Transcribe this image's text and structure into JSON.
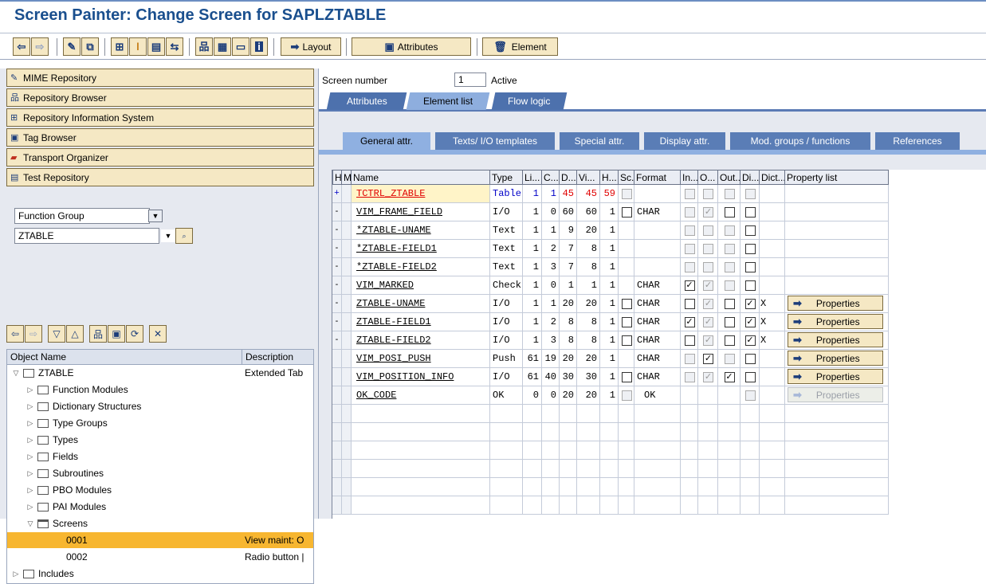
{
  "title": "Screen Painter: Change Screen for SAPLZTABLE",
  "toolbar": {
    "icons": [
      "back-icon",
      "forward-icon",
      "pencil-display-change-icon",
      "activate-icon",
      "where-used-icon",
      "check-icon",
      "object-list-icon",
      "navigation-icon",
      "hierarchy-icon",
      "program-icon",
      "screen-icon",
      "info-icon"
    ],
    "layout_label": "Layout",
    "attributes_label": "Attributes",
    "element_label": "Element"
  },
  "nav": [
    "MIME Repository",
    "Repository Browser",
    "Repository Information System",
    "Tag Browser",
    "Transport Organizer",
    "Test Repository"
  ],
  "object_type": "Function Group",
  "object_name": "ZTABLE",
  "tree": {
    "col_name": "Object Name",
    "col_desc": "Description",
    "root": {
      "label": "ZTABLE",
      "desc": "Extended Tab"
    },
    "folders": [
      "Function Modules",
      "Dictionary Structures",
      "Type Groups",
      "Types",
      "Fields",
      "Subroutines",
      "PBO Modules",
      "PAI Modules"
    ],
    "screens_label": "Screens",
    "screens": [
      {
        "label": "0001",
        "desc": "View maint: O"
      },
      {
        "label": "0002",
        "desc": "Radio button |"
      }
    ],
    "includes_label": "Includes"
  },
  "screen": {
    "label": "Screen number",
    "value": "1",
    "status": "Active"
  },
  "tabs": [
    "Attributes",
    "Element list",
    "Flow logic"
  ],
  "subtabs": [
    "General attr.",
    "Texts/ I/O templates",
    "Special attr.",
    "Display attr.",
    "Mod. groups / functions",
    "References"
  ],
  "grid": {
    "headers": [
      "H",
      "M",
      "Name",
      "Type",
      "Li...",
      "C...",
      "D...",
      "Vi...",
      "H...",
      "Sc...",
      "Format",
      "In...",
      "O...",
      "Out...",
      "Di...",
      "Dict...",
      "Property list"
    ],
    "rows": [
      {
        "h": "+",
        "name": "TCTRL_ZTABLE",
        "type": "Table",
        "li": "1",
        "c": "1",
        "d": "45",
        "vi": "45",
        "hh": "59",
        "sc": "dis",
        "format": "",
        "in": "dis",
        "o": "dis",
        "out": "dis",
        "di": "dis",
        "dict": "",
        "prop": "",
        "special": "tctrl"
      },
      {
        "h": "-",
        "name": "VIM_FRAME_FIELD",
        "type": "I/O",
        "li": "1",
        "c": "0",
        "d": "60",
        "vi": "60",
        "hh": "1",
        "sc": "off",
        "format": "CHAR",
        "in": "dis",
        "o": "disck",
        "out": "off",
        "di": "off",
        "dict": "",
        "prop": ""
      },
      {
        "h": "-",
        "name": "*ZTABLE-UNAME",
        "type": "Text",
        "li": "1",
        "c": "1",
        "d": "9",
        "vi": "20",
        "hh": "1",
        "sc": "",
        "format": "",
        "in": "dis",
        "o": "dis",
        "out": "dis",
        "di": "off",
        "dict": "",
        "prop": ""
      },
      {
        "h": "-",
        "name": "*ZTABLE-FIELD1",
        "type": "Text",
        "li": "1",
        "c": "2",
        "d": "7",
        "vi": "8",
        "hh": "1",
        "sc": "",
        "format": "",
        "in": "dis",
        "o": "dis",
        "out": "dis",
        "di": "off",
        "dict": "",
        "prop": ""
      },
      {
        "h": "-",
        "name": "*ZTABLE-FIELD2",
        "type": "Text",
        "li": "1",
        "c": "3",
        "d": "7",
        "vi": "8",
        "hh": "1",
        "sc": "",
        "format": "",
        "in": "dis",
        "o": "dis",
        "out": "dis",
        "di": "off",
        "dict": "",
        "prop": ""
      },
      {
        "h": "-",
        "name": "VIM_MARKED",
        "type": "Check",
        "li": "1",
        "c": "0",
        "d": "1",
        "vi": "1",
        "hh": "1",
        "sc": "",
        "format": "CHAR",
        "in": "on",
        "o": "disck",
        "out": "dis",
        "di": "off",
        "dict": "",
        "prop": ""
      },
      {
        "h": "-",
        "name": "ZTABLE-UNAME",
        "type": "I/O",
        "li": "1",
        "c": "1",
        "d": "20",
        "vi": "20",
        "hh": "1",
        "sc": "off",
        "format": "CHAR",
        "in": "off",
        "o": "disck",
        "out": "off",
        "di": "on",
        "dict": "X",
        "prop": "Properties"
      },
      {
        "h": "-",
        "name": "ZTABLE-FIELD1",
        "type": "I/O",
        "li": "1",
        "c": "2",
        "d": "8",
        "vi": "8",
        "hh": "1",
        "sc": "off",
        "format": "CHAR",
        "in": "on",
        "o": "disck",
        "out": "off",
        "di": "on",
        "dict": "X",
        "prop": "Properties"
      },
      {
        "h": "-",
        "name": "ZTABLE-FIELD2",
        "type": "I/O",
        "li": "1",
        "c": "3",
        "d": "8",
        "vi": "8",
        "hh": "1",
        "sc": "off",
        "format": "CHAR",
        "in": "off",
        "o": "disck",
        "out": "off",
        "di": "on",
        "dict": "X",
        "prop": "Properties"
      },
      {
        "h": "",
        "name": "VIM_POSI_PUSH",
        "type": "Push",
        "li": "61",
        "c": "19",
        "d": "20",
        "vi": "20",
        "hh": "1",
        "sc": "",
        "format": "CHAR",
        "in": "dis",
        "o": "on",
        "out": "dis",
        "di": "off",
        "dict": "",
        "prop": "Properties"
      },
      {
        "h": "",
        "name": "VIM_POSITION_INFO",
        "type": "I/O",
        "li": "61",
        "c": "40",
        "d": "30",
        "vi": "30",
        "hh": "1",
        "sc": "off",
        "format": "CHAR",
        "in": "dis",
        "o": "disck",
        "out": "on",
        "di": "off",
        "dict": "",
        "prop": "Properties"
      },
      {
        "h": "",
        "name": "OK_CODE",
        "type": "OK",
        "li": "0",
        "c": "0",
        "d": "20",
        "vi": "20",
        "hh": "1",
        "sc": "dis",
        "format": "OK",
        "in": "",
        "o": "",
        "out": "",
        "di": "dis",
        "dict": "",
        "prop": "Properties",
        "propdis": true
      }
    ]
  },
  "colors": {
    "title": "#1a4f8e",
    "tab_dark": "#4d71ad",
    "tab_light": "#8eaede",
    "selected": "#f7b630",
    "accent_red": "#e00000",
    "accent_blue": "#0000c8"
  }
}
